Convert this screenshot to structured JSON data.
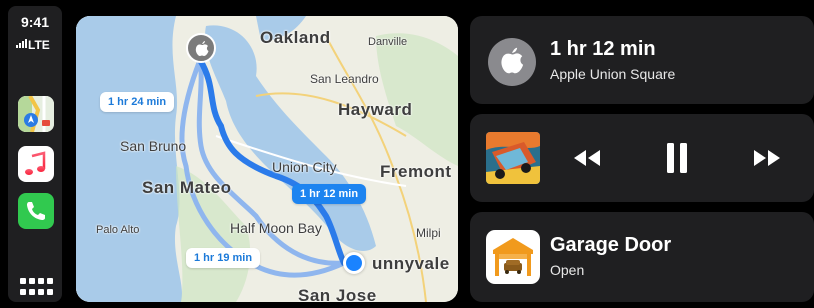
{
  "status": {
    "time": "9:41",
    "network": "LTE"
  },
  "dock": {
    "apps": [
      {
        "name": "Maps",
        "icon": "maps-icon"
      },
      {
        "name": "Music",
        "icon": "music-icon"
      },
      {
        "name": "Phone",
        "icon": "phone-icon"
      }
    ],
    "home_icon": "app-grid-icon"
  },
  "map": {
    "places": [
      "Oakland",
      "Danville",
      "San Leandro",
      "Hayward",
      "San Bruno",
      "Union City",
      "Fremont",
      "San Mateo",
      "Palo Alto",
      "Half Moon Bay",
      "Milpi",
      "unnyvale",
      "San Jose"
    ],
    "route_options": [
      {
        "label": "1 hr 24 min",
        "active": false
      },
      {
        "label": "1 hr 12 min",
        "active": true
      },
      {
        "label": "1 hr 19 min",
        "active": false
      }
    ],
    "colors": {
      "route": "#2b7bea",
      "alt_route": "#8fb6ee",
      "water": "#a8c8e8"
    }
  },
  "navigation": {
    "eta": "1 hr 12 min",
    "destination": "Apple Union Square"
  },
  "now_playing": {
    "controls": [
      "rewind-icon",
      "pause-icon",
      "fast-forward-icon"
    ]
  },
  "garage": {
    "title": "Garage Door",
    "status": "Open"
  }
}
